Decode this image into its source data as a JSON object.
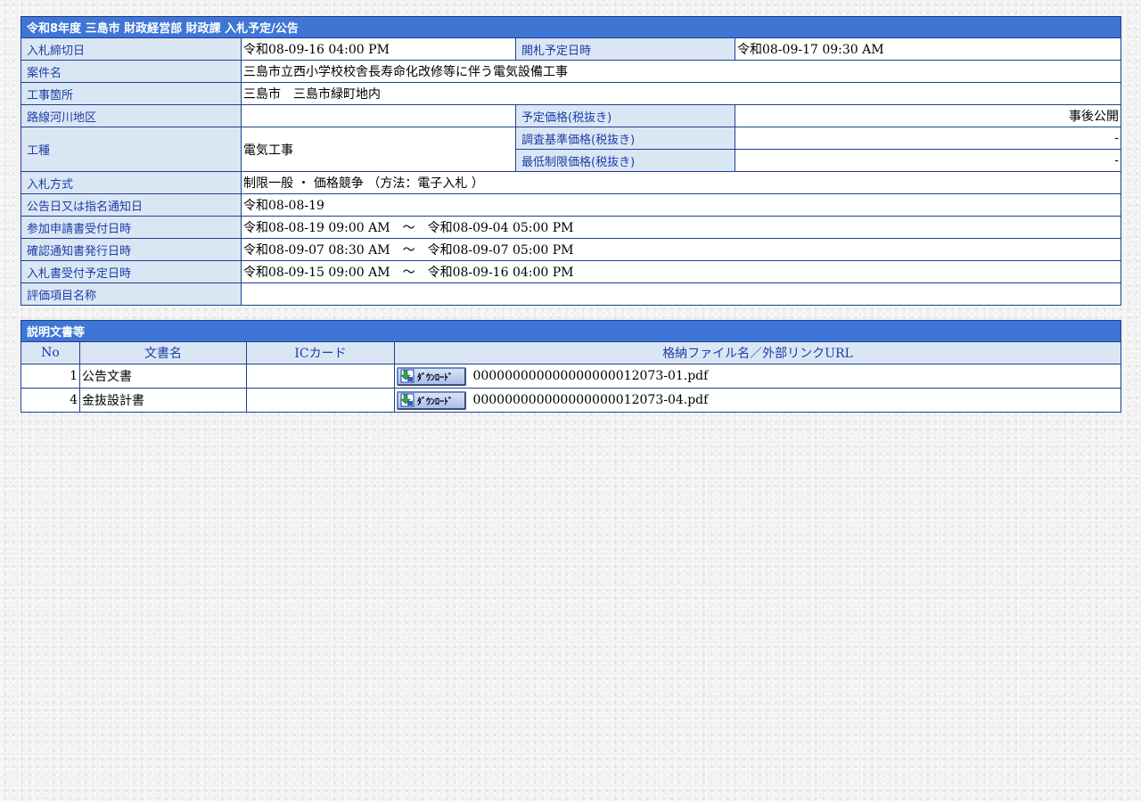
{
  "header": {
    "title": "令和8年度 三島市 財政経営部 財政課 入札予定/公告"
  },
  "info": {
    "deadline_label": "入札締切日",
    "deadline_value": "令和08-09-16 04:00 PM",
    "opening_label": "開札予定日時",
    "opening_value": "令和08-09-17 09:30 AM",
    "case_label": "案件名",
    "case_value": "三島市立西小学校校舎長寿命化改修等に伴う電気設備工事",
    "site_label": "工事箇所",
    "site_value": "三島市　三島市緑町地内",
    "route_label": "路線河川地区",
    "route_value": "",
    "planned_price_label": "予定価格(税抜き)",
    "planned_price_value": "事後公開",
    "work_type_label": "工種",
    "work_type_value": "電気工事",
    "survey_price_label": "調査基準価格(税抜き)",
    "survey_price_value": "-",
    "min_price_label": "最低制限価格(税抜き)",
    "min_price_value": "-",
    "method_label": "入札方式",
    "method_value": "制限一般 ・ 価格競争 （方法：電子入札 ）",
    "notice_date_label": "公告日又は指名通知日",
    "notice_date_value": "令和08-08-19",
    "apply_label": "参加申請書受付日時",
    "apply_value": "令和08-08-19 09:00 AM　～　令和08-09-04 05:00 PM",
    "confirm_label": "確認通知書発行日時",
    "confirm_value": "令和08-09-07 08:30 AM　～　令和08-09-07 05:00 PM",
    "bid_recv_label": "入札書受付予定日時",
    "bid_recv_value": "令和08-09-15 09:00 AM　～　令和08-09-16 04:00 PM",
    "eval_label": "評価項目名称",
    "eval_value": ""
  },
  "documents": {
    "title": "説明文書等",
    "columns": {
      "no": "No",
      "name": "文書名",
      "ic": "ICカード",
      "file": "格納ファイル名／外部リンクURL"
    },
    "download_label": "ﾀﾞｳﾝﾛｰﾄﾞ",
    "rows": [
      {
        "no": "1",
        "name": "公告文書",
        "ic": "",
        "file": "000000000000000000012073-01.pdf"
      },
      {
        "no": "4",
        "name": "金抜設計書",
        "ic": "",
        "file": "000000000000000000012073-04.pdf"
      }
    ]
  }
}
